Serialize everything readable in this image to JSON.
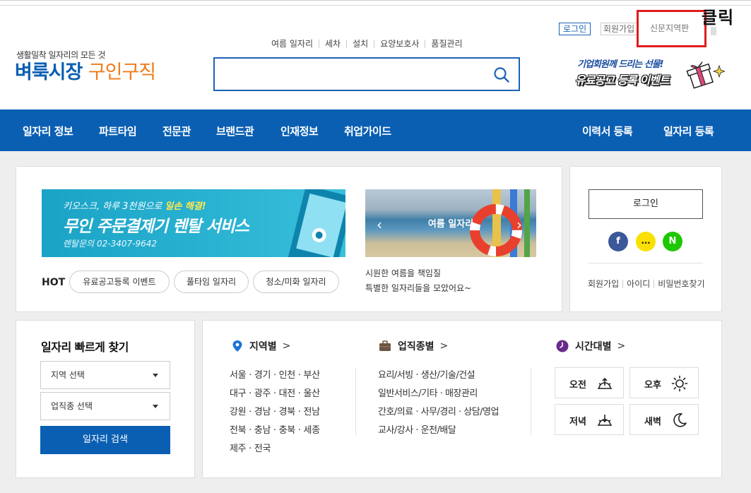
{
  "header": {
    "logo_sub": "생활밀착 일자리의 모든 것",
    "logo_main": "벼룩시장",
    "logo_accent": "구인구직",
    "quick_links": [
      "여름 일자리",
      "세차",
      "설치",
      "요양보호사",
      "품질관리"
    ],
    "search_placeholder": "",
    "login": "로그인",
    "join": "회원가입",
    "newspaper": "신문지역판",
    "annotation": "클릭",
    "promo_line1": "기업회원께 드리는 선물!",
    "promo_line2": "유료공고 등록 이벤트"
  },
  "nav": {
    "left": [
      "일자리 정보",
      "파트타임",
      "전문관",
      "브랜드관",
      "인재정보",
      "취업가이드"
    ],
    "right": [
      "이력서 등록",
      "일자리 등록"
    ]
  },
  "banner1": {
    "line1_prefix": "키오스크, 하루 3천원으로 ",
    "line1_highlight": "일손 해결!",
    "line2": "무인 주문결제기 렌탈 서비스",
    "line3": "렌탈문의 02-3407-9642"
  },
  "banner2": {
    "label": "여름 일자리",
    "caption1": "시원한 여름을 책임질",
    "caption2": "특별한 일자리들을 모았어요~"
  },
  "hot": {
    "label": "HOT",
    "tags": [
      "유료공고등록 이벤트",
      "풀타임 일자리",
      "청소/미화 일자리"
    ]
  },
  "login_box": {
    "button": "로그인",
    "social": [
      "f",
      "…",
      "N"
    ],
    "links": [
      "회원가입",
      "아이디",
      "비밀번호찾기"
    ]
  },
  "quick_search": {
    "title": "일자리 빠르게 찾기",
    "region_select": "지역 선택",
    "job_select": "업직종 선택",
    "button": "일자리 검색"
  },
  "region": {
    "title": "지역별",
    "rows": [
      "서울 · 경기 · 인천 · 부산",
      "대구 · 광주 · 대전 · 울산",
      "강원 · 경남 · 경북 · 전남",
      "전북 · 충남 · 충북 · 세종",
      "제주 · 전국"
    ]
  },
  "jobtype": {
    "title": "업직종별",
    "rows": [
      "요리/서빙 · 생산/기술/건설",
      "일반서비스/기타 · 매장관리",
      "간호/의료 · 사무/경리 · 상담/영업",
      "교사/강사 · 운전/배달"
    ]
  },
  "timeslot": {
    "title": "시간대별",
    "items": [
      "오전",
      "오후",
      "저녁",
      "새벽"
    ]
  },
  "colors": {
    "brand_blue": "#0b5fb3",
    "brand_orange": "#f07c1a",
    "annotation_red": "#e01c1c",
    "facebook": "#3b5998",
    "kakao": "#f9e000",
    "naver": "#1ec800"
  }
}
